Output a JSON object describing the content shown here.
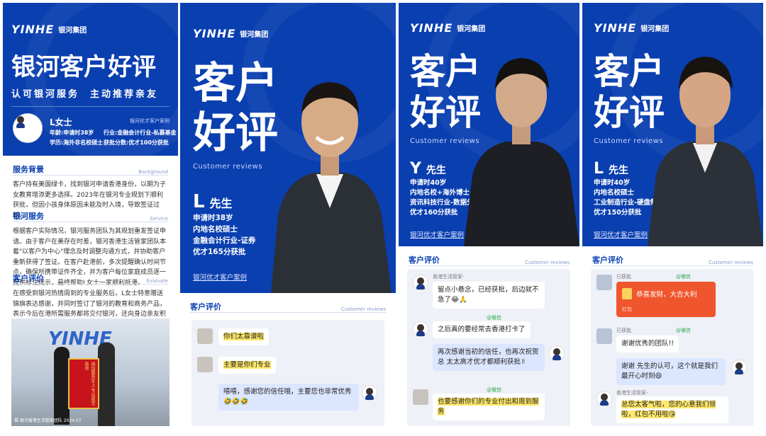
{
  "brand": {
    "mark": "YINHE",
    "name": "银河集团",
    "blue": "#0a3fb0"
  },
  "panel1": {
    "title": "银河客户好评",
    "tagline": "认可银河服务  主动推荐亲友",
    "client_name": "L女士",
    "case_label": "银河优才客户案例",
    "age": "年龄:申请时38岁",
    "industry": "行业:金融会计行业-私募基金",
    "education": "学历:海外非名校硕士",
    "score": "获批分数:优才100分获批",
    "sections": [
      {
        "title": "服务背景",
        "en": "Background",
        "text": "客户持有美国绿卡，找到银河申请香港身份，以期为子女教育增添更多选择。2023年在银河专业规划下顺利获批，但因小孩身体原因未能及时入境，导致签证过期。"
      },
      {
        "title": "银河服务",
        "en": "Service",
        "text": "根据客户实际情况，银河服务团队为其规划重发签证申请。由于客户在美存在时差，银河香港生活管家团队本着\"以客户为中心\"理念及时调整沟通方式，并协助客户重新获得了签证。在客户赴港前，多次提醒确认时间节点，确保所携带证件齐全，并为客户每位家庭成员逐一提供标注提示，最终帮助L女士一家顺利抵港。"
      },
      {
        "title": "客户评价",
        "en": "Evaluate",
        "text": "在感受到银河热情周到的专业服务后，L女士特意赠送锦旗表达感谢，并同时签订了银河的教育和商务产品，表示今后在港所需服务都将交付银河，还向身边亲友积极推荐。"
      }
    ],
    "photo_caption": "摄 银河香港生活管家团队 2024.07",
    "banner_text": "诚信服务至上 专业规范高效"
  },
  "panel2": {
    "title1": "客户",
    "title2": "好评",
    "sub": "Customer reviews",
    "name_letter": "L",
    "name_suffix": "先生",
    "lines": [
      "申请时38岁",
      "内地名校硕士",
      "金融会计行业-证券",
      "优才165分获批"
    ],
    "case": "银河优才客户案例",
    "review_title": "客户评价",
    "review_en": "Customer reviews",
    "msgs": [
      "你们太靠谱啦",
      "主要是你们专业",
      "嘻嘻，感谢您的信任哦，主要您也非常优秀🤣🤣🤣"
    ]
  },
  "panel3": {
    "title1": "客户",
    "title2": "好评",
    "sub": "Customer reviews",
    "name_letter": "Y",
    "name_suffix": "先生",
    "lines": [
      "申请时40岁",
      "内地名校+海外博士",
      "资讯科技行业-数据分析",
      "优才160分获批"
    ],
    "case": "银河优才客户案例",
    "review_title": "客户评价",
    "review_en": "Customer reviews",
    "sender": "香港生活管家-",
    "wechat": "@微信",
    "msgs": [
      "留点小悬念，已经获批，后边就不急了😂🙏",
      "之后真的要经常去香港打卡了",
      "再次感谢当初的信任，也再次祝贺  总  太太高才优才都顺利获批✌",
      "也要感谢你们的专业付出和周到服务"
    ]
  },
  "panel4": {
    "title1": "客户",
    "title2": "好评",
    "sub": "Customer reviews",
    "name_letter": "L",
    "name_suffix": "先生",
    "lines": [
      "申请时40岁",
      "内地名校硕士",
      "工业制造行业-硬盘制造",
      "优才150分获批"
    ],
    "case": "银河优才客户案例",
    "review_title": "客户评价",
    "review_en": "Customer reviews",
    "status1": "已获批",
    "wechat": "@微信",
    "redpacket": "恭喜发财，大吉大利",
    "redpacket_label": "红包",
    "sender": "香港生活管家-",
    "msgs": [
      "谢谢优秀的团队!!",
      "谢谢  先生的认可，这个就是我们最开心时刻😄",
      "  总您太客气啦，您的心意我们领啦，红包不用啦😘"
    ]
  }
}
